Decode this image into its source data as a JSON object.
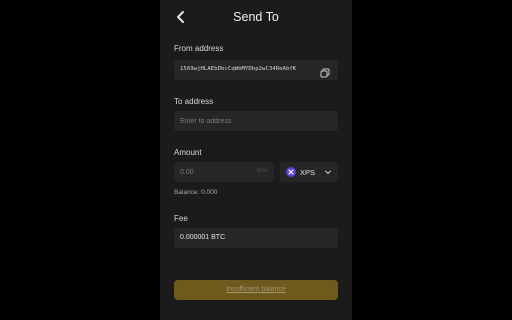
{
  "header": {
    "title": "Send To",
    "back_icon": "chevron-left-icon"
  },
  "from": {
    "label": "From address",
    "address": "1569wjHLAEbDbcCqWbMYDbp2wC34ReAbfK",
    "copy_icon": "copy-icon"
  },
  "to": {
    "label": "To address",
    "placeholder": "Enter to address",
    "value": ""
  },
  "amount": {
    "label": "Amount",
    "placeholder": "0.00",
    "max_label": "Max",
    "token": {
      "name": "XPS",
      "icon": "token-xps-icon",
      "color": "#5b3fe0"
    },
    "balance_text": "Balance: 0.000"
  },
  "fee": {
    "label": "Fee",
    "value": "0.000001 BTC"
  },
  "cta": {
    "label": "Insufficient balance",
    "color": "#6e5a1d"
  }
}
